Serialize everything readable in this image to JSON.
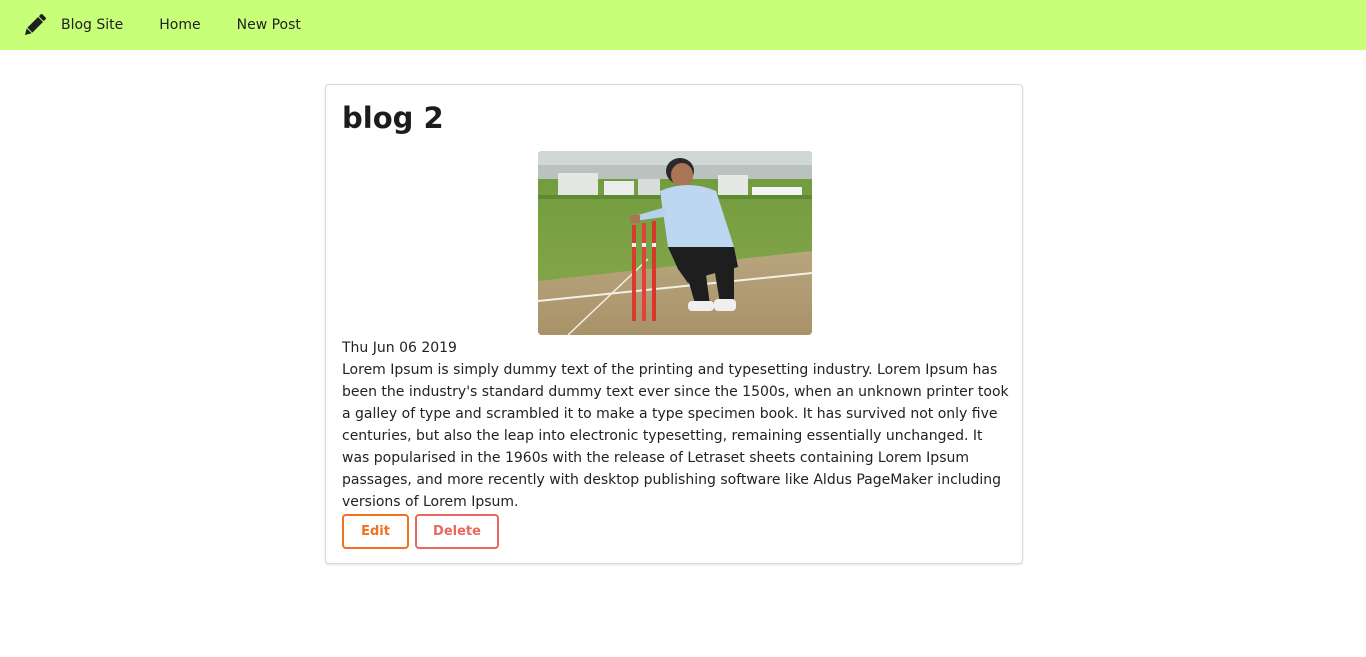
{
  "nav": {
    "brand_label": "Blog Site",
    "brand_icon": "pencil-icon",
    "items": [
      {
        "label": "Home"
      },
      {
        "label": "New Post"
      }
    ],
    "background_color": "#c8ff78"
  },
  "post": {
    "title": "blog 2",
    "image_alt": "cricket umpire placing stumps",
    "date": "Thu Jun 06 2019",
    "body": "Lorem Ipsum is simply dummy text of the printing and typesetting industry. Lorem Ipsum has been the industry's standard dummy text ever since the 1500s, when an unknown printer took a galley of type and scrambled it to make a type specimen book. It has survived not only five centuries, but also the leap into electronic typesetting, remaining essentially unchanged. It was popularised in the 1960s with the release of Letraset sheets containing Lorem Ipsum passages, and more recently with desktop publishing software like Aldus PageMaker including versions of Lorem Ipsum.",
    "edit_label": "Edit",
    "delete_label": "Delete",
    "edit_color": "#f2711c",
    "delete_color": "#e8675f"
  }
}
